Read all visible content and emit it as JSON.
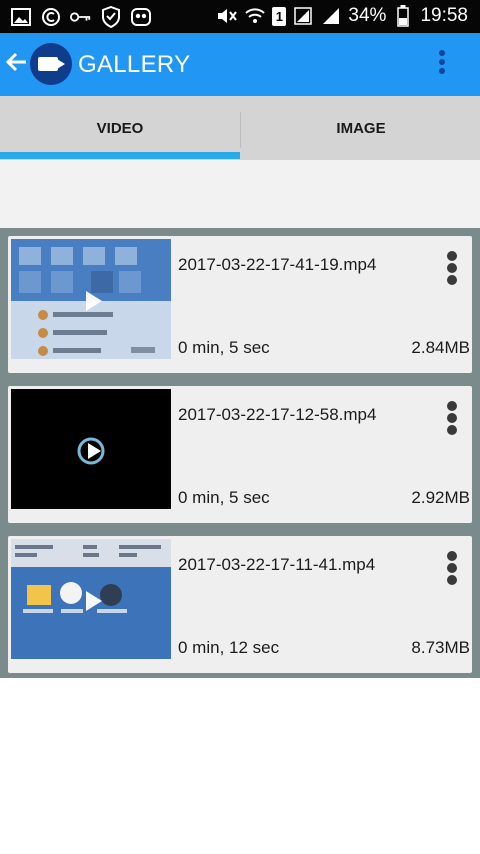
{
  "status_bar": {
    "left_icons": [
      "image-icon",
      "copyright-icon",
      "key-icon",
      "shield-icon",
      "owl-icon"
    ],
    "right_icons": [
      "mute-icon",
      "wifi-icon",
      "sim1-icon",
      "signal-icon",
      "signal-icon",
      "battery-icon"
    ],
    "sim_label": "1",
    "battery": "34%",
    "time": "19:58"
  },
  "app_bar": {
    "title": "GALLERY",
    "back_icon": "back-arrow-icon",
    "logo_icon": "video-camera-logo-icon",
    "menu_icon": "more-vert-icon",
    "color": "#2196f3"
  },
  "tabs": [
    {
      "label": "VIDEO",
      "selected": true
    },
    {
      "label": "IMAGE",
      "selected": false
    }
  ],
  "accent_color": "#29a9e7",
  "videos": [
    {
      "filename": "2017-03-22-17-41-19.mp4",
      "duration": "0 min, 5 sec",
      "size": "2.84MB"
    },
    {
      "filename": "2017-03-22-17-12-58.mp4",
      "duration": "0 min, 5 sec",
      "size": "2.92MB"
    },
    {
      "filename": "2017-03-22-17-11-41.mp4",
      "duration": "0 min, 12 sec",
      "size": "8.73MB"
    }
  ]
}
